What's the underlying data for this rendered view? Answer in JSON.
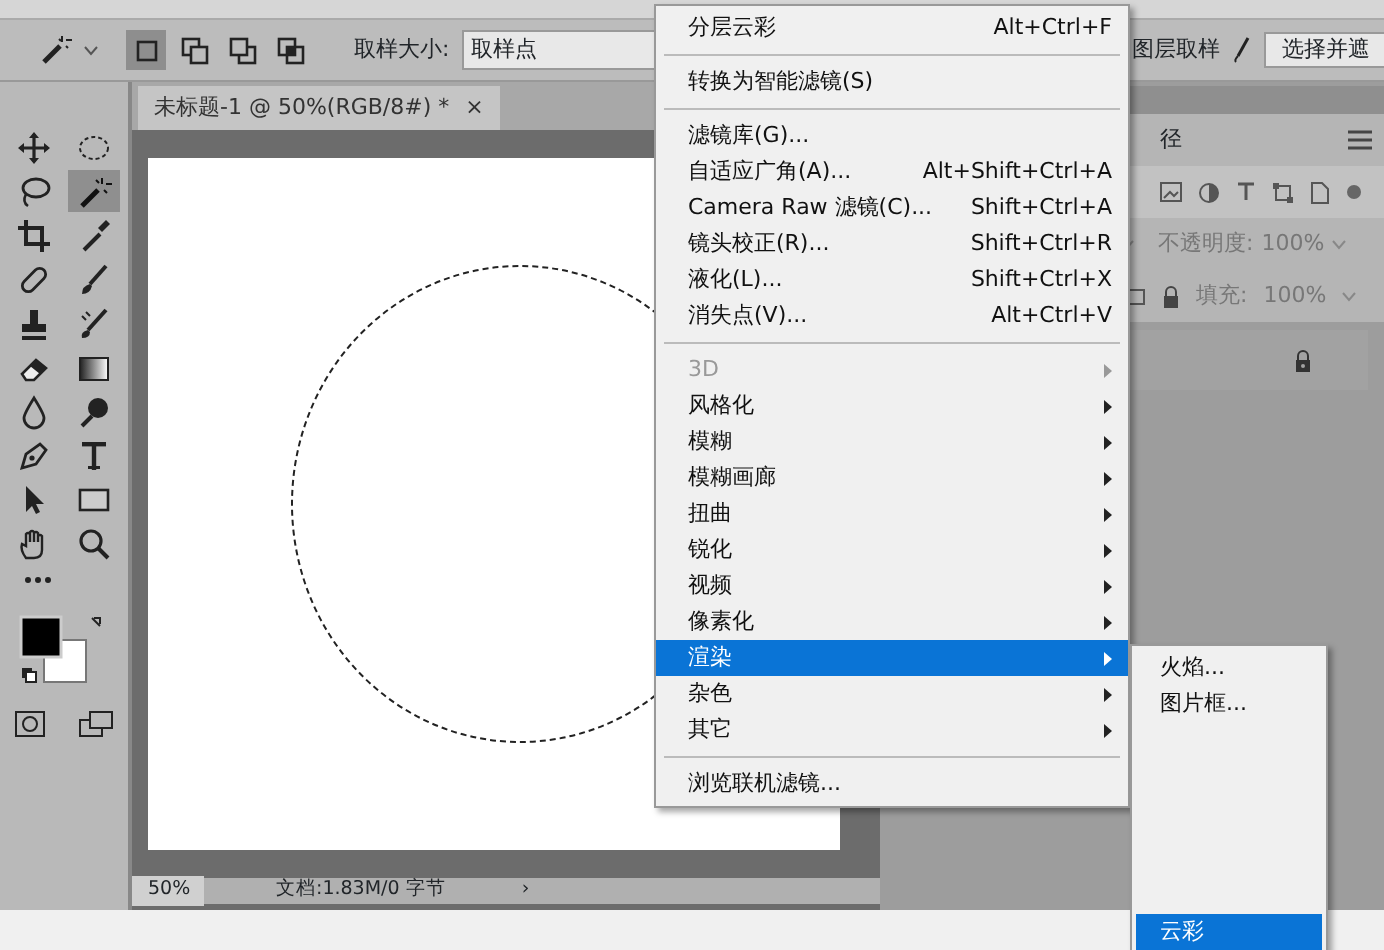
{
  "options_bar": {
    "mode_buttons": [
      {
        "selected": true
      },
      {
        "selected": false
      },
      {
        "selected": false
      },
      {
        "selected": false
      }
    ],
    "sample_size_label": "取样大小:",
    "sample_size_value": "取样点",
    "sample_all_layers_label": "图层取样",
    "select_mask_button": "选择并遮"
  },
  "tools": [
    {
      "selected": false
    },
    {
      "selected": false
    },
    {
      "selected": false
    },
    {
      "selected": true
    },
    {
      "selected": false
    },
    {
      "selected": false
    },
    {
      "selected": false
    },
    {
      "selected": false
    },
    {
      "selected": false
    },
    {
      "selected": false
    },
    {
      "selected": false
    },
    {
      "selected": false
    },
    {
      "selected": false
    },
    {
      "selected": false
    },
    {
      "selected": false
    },
    {
      "selected": false
    },
    {
      "selected": false
    },
    {
      "selected": false
    },
    {
      "selected": false
    },
    {
      "selected": false
    }
  ],
  "document": {
    "tab_title": "未标题-1 @ 50%(RGB/8#) *",
    "tab_close": "×",
    "zoom": "50%",
    "doc_info": "文档:1.83M/0 字节",
    "status_arrow": "›"
  },
  "layers_panel": {
    "tab": "径",
    "opacity_label": "不透明度:",
    "opacity_value": "100%",
    "fill_label": "填充:",
    "fill_value": "100%"
  },
  "filter_menu": {
    "groups": [
      [
        {
          "label": "分层云彩",
          "shortcut": "Alt+Ctrl+F",
          "submenu": false,
          "disabled": false,
          "selected": false
        }
      ],
      [
        {
          "label": "转换为智能滤镜(S)",
          "submenu": false,
          "disabled": false,
          "selected": false
        }
      ],
      [
        {
          "label": "滤镜库(G)...",
          "submenu": false,
          "disabled": false,
          "selected": false
        },
        {
          "label": "自适应广角(A)...",
          "shortcut": "Alt+Shift+Ctrl+A",
          "submenu": false,
          "disabled": false,
          "selected": false
        },
        {
          "label": "Camera Raw 滤镜(C)...",
          "shortcut": "Shift+Ctrl+A",
          "submenu": false,
          "disabled": false,
          "selected": false
        },
        {
          "label": "镜头校正(R)...",
          "shortcut": "Shift+Ctrl+R",
          "submenu": false,
          "disabled": false,
          "selected": false
        },
        {
          "label": "液化(L)...",
          "shortcut": "Shift+Ctrl+X",
          "submenu": false,
          "disabled": false,
          "selected": false
        },
        {
          "label": "消失点(V)...",
          "shortcut": "Alt+Ctrl+V",
          "submenu": false,
          "disabled": false,
          "selected": false
        }
      ],
      [
        {
          "label": "3D",
          "submenu": true,
          "disabled": true,
          "selected": false
        },
        {
          "label": "风格化",
          "submenu": true,
          "disabled": false,
          "selected": false
        },
        {
          "label": "模糊",
          "submenu": true,
          "disabled": false,
          "selected": false
        },
        {
          "label": "模糊画廊",
          "submenu": true,
          "disabled": false,
          "selected": false
        },
        {
          "label": "扭曲",
          "submenu": true,
          "disabled": false,
          "selected": false
        },
        {
          "label": "锐化",
          "submenu": true,
          "disabled": false,
          "selected": false
        },
        {
          "label": "视频",
          "submenu": true,
          "disabled": false,
          "selected": false
        },
        {
          "label": "像素化",
          "submenu": true,
          "disabled": false,
          "selected": false
        },
        {
          "label": "渲染",
          "submenu": true,
          "disabled": false,
          "selected": true
        },
        {
          "label": "杂色",
          "submenu": true,
          "disabled": false,
          "selected": false
        },
        {
          "label": "其它",
          "submenu": true,
          "disabled": false,
          "selected": false
        }
      ],
      [
        {
          "label": "浏览联机滤镜...",
          "submenu": false,
          "disabled": false,
          "selected": false
        }
      ]
    ]
  },
  "render_submenu": {
    "items": [
      {
        "label": "火焰...",
        "selected": false
      },
      {
        "label": "图片框...",
        "selected": false
      },
      {
        "label": "云彩",
        "selected": true
      }
    ]
  }
}
